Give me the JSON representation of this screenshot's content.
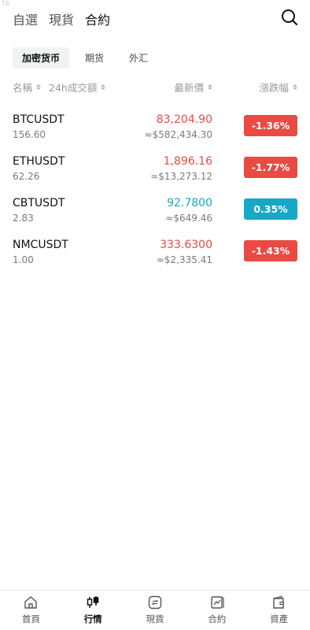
{
  "corner_label": "T8",
  "top_tabs": [
    {
      "label": "自選"
    },
    {
      "label": "現貨"
    },
    {
      "label": "合約"
    }
  ],
  "icons": {
    "search": "search-icon"
  },
  "sub_tabs": [
    {
      "label": "加密货币"
    },
    {
      "label": "期货"
    },
    {
      "label": "外汇"
    }
  ],
  "columns": {
    "name": "名稱",
    "volume": "24h成交額",
    "price": "最新價",
    "change": "漲跌幅"
  },
  "colors": {
    "up": "#17a8c6",
    "down": "#ea4a43"
  },
  "rows": [
    {
      "symbol": "BTCUSDT",
      "volume": "156.60",
      "price": "83,204.90",
      "converted": "≈$582,434.30",
      "change": "-1.36%",
      "direction": "down"
    },
    {
      "symbol": "ETHUSDT",
      "volume": "62.26",
      "price": "1,896.16",
      "converted": "≈$13,273.12",
      "change": "-1.77%",
      "direction": "down"
    },
    {
      "symbol": "CBTUSDT",
      "volume": "2.83",
      "price": "92.7800",
      "converted": "≈$649.46",
      "change": "0.35%",
      "direction": "up"
    },
    {
      "symbol": "NMCUSDT",
      "volume": "1.00",
      "price": "333.6300",
      "converted": "≈$2,335.41",
      "change": "-1.43%",
      "direction": "down"
    }
  ],
  "bottom_nav": [
    {
      "label": "首頁",
      "icon": "home-icon"
    },
    {
      "label": "行情",
      "icon": "candlestick-icon"
    },
    {
      "label": "現貨",
      "icon": "spot-exchange-icon"
    },
    {
      "label": "合約",
      "icon": "contract-icon"
    },
    {
      "label": "資產",
      "icon": "wallet-icon"
    }
  ]
}
